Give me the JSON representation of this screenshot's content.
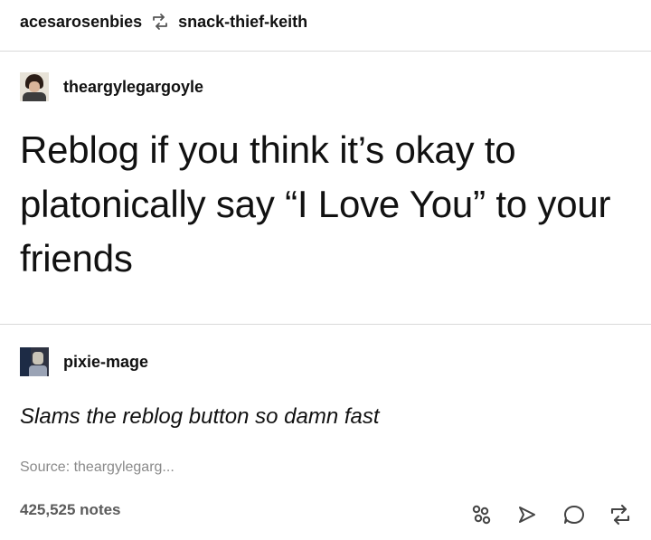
{
  "header": {
    "reblogger": "acesarosenbies",
    "reblogged_from": "snack-thief-keith",
    "icon": "reblog-icon"
  },
  "original_post": {
    "author": "theargylegargoyle",
    "text": "Reblog if you think it’s okay to platonically say “I Love You” to your friends"
  },
  "reply": {
    "author": "pixie-mage",
    "text": "Slams the reblog button so damn fast"
  },
  "source": {
    "text": "Source: theargylegarg..."
  },
  "footer": {
    "notes": "425,525 notes",
    "action_icons": [
      "share-icon",
      "send-icon",
      "comment-icon",
      "reblog-icon"
    ]
  },
  "colors": {
    "text": "#111111",
    "muted": "#8a8a8a",
    "notes": "#5b5b5b",
    "divider": "#d9d9d9"
  }
}
